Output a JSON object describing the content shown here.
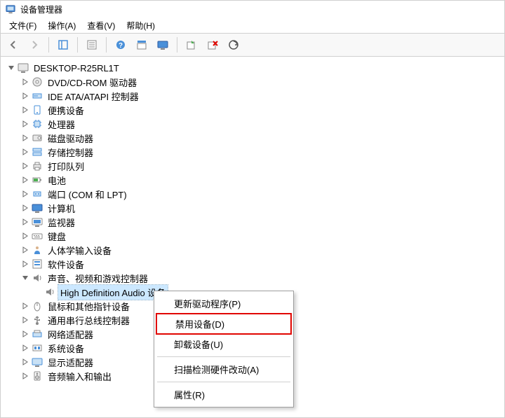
{
  "window": {
    "title": "设备管理器"
  },
  "menubar": {
    "file": "文件(F)",
    "action": "操作(A)",
    "view": "查看(V)",
    "help": "帮助(H)"
  },
  "root": {
    "name": "DESKTOP-R25RL1T"
  },
  "categories": [
    {
      "label": "DVD/CD-ROM 驱动器",
      "icon": "disc"
    },
    {
      "label": "IDE ATA/ATAPI 控制器",
      "icon": "ide"
    },
    {
      "label": "便携设备",
      "icon": "portable"
    },
    {
      "label": "处理器",
      "icon": "cpu"
    },
    {
      "label": "磁盘驱动器",
      "icon": "disk"
    },
    {
      "label": "存储控制器",
      "icon": "storage"
    },
    {
      "label": "打印队列",
      "icon": "print"
    },
    {
      "label": "电池",
      "icon": "battery"
    },
    {
      "label": "端口 (COM 和 LPT)",
      "icon": "port"
    },
    {
      "label": "计算机",
      "icon": "computer"
    },
    {
      "label": "监视器",
      "icon": "monitor"
    },
    {
      "label": "键盘",
      "icon": "keyboard"
    },
    {
      "label": "人体学输入设备",
      "icon": "hid"
    },
    {
      "label": "软件设备",
      "icon": "software"
    },
    {
      "label": "声音、视频和游戏控制器",
      "icon": "sound",
      "expanded": true,
      "children": [
        {
          "label": "High Definition Audio 设备",
          "icon": "sound",
          "selected": true
        }
      ]
    },
    {
      "label": "鼠标和其他指针设备",
      "icon": "mouse"
    },
    {
      "label": "通用串行总线控制器",
      "icon": "usb"
    },
    {
      "label": "网络适配器",
      "icon": "network"
    },
    {
      "label": "系统设备",
      "icon": "system"
    },
    {
      "label": "显示适配器",
      "icon": "display"
    },
    {
      "label": "音频输入和输出",
      "icon": "audio"
    }
  ],
  "context_menu": {
    "update_driver": "更新驱动程序(P)",
    "disable_device": "禁用设备(D)",
    "uninstall_device": "卸载设备(U)",
    "scan_hardware": "扫描检测硬件改动(A)",
    "properties": "属性(R)"
  }
}
